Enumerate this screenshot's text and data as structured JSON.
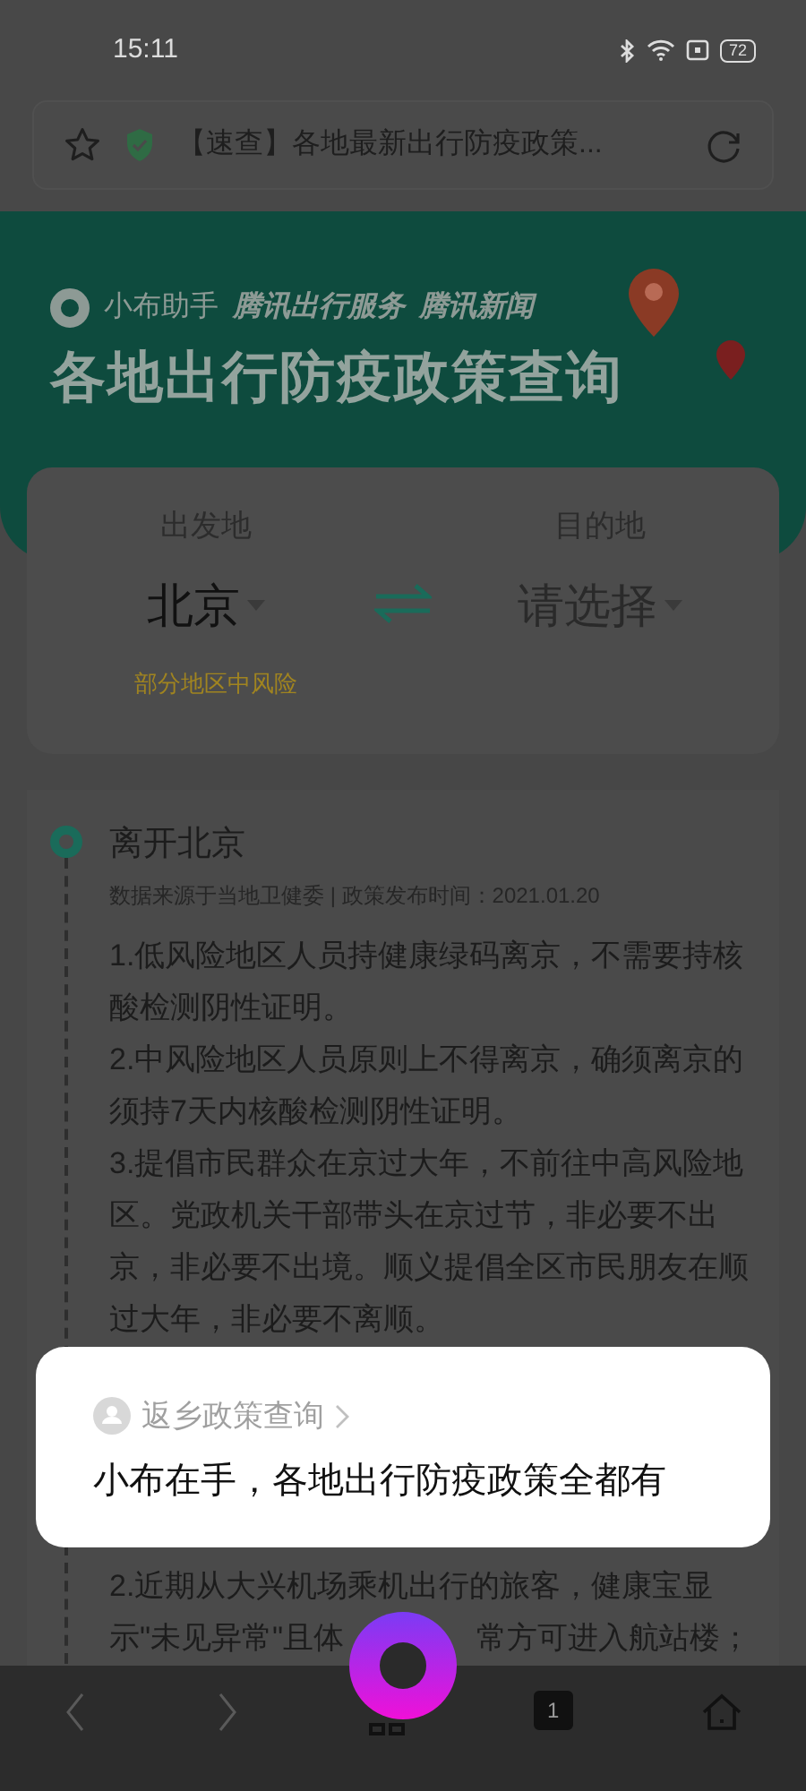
{
  "status_bar": {
    "time": "15:11",
    "battery": "72"
  },
  "address_bar": {
    "title": "【速查】各地最新出行防疫政策..."
  },
  "banner": {
    "brands": [
      "小布助手",
      "腾讯出行服务",
      "腾讯新闻"
    ],
    "title": "各地出行防疫政策查询"
  },
  "route_card": {
    "origin_label": "出发地",
    "origin": "北京",
    "destination_label": "目的地",
    "destination_placeholder": "请选择",
    "risk_note": "部分地区中风险"
  },
  "sections": [
    {
      "title": "离开北京",
      "source": "数据来源于当地卫健委 | 政策发布时间：2021.01.20",
      "paragraphs": [
        "1.低风险地区人员持健康绿码离京，不需要持核酸检测阴性证明。",
        "2.中风险地区人员原则上不得离京，确须离京的须持7天内核酸检测阴性证明。",
        "3.提倡市民群众在京过大年，不前往中高风险地区。党政机关干部带头在京过节，非必要不出京，非必要不出境。顺义提倡全区市民朋友在顺过大年，非必要不离顺。"
      ]
    }
  ],
  "continued": {
    "line_1": "2.近期从大兴机场乘机出行的旅客，健康宝显",
    "line_2_before": "示\"未见异常\"且体",
    "line_2_after": "常方可进入航站楼；"
  },
  "popup": {
    "source": "返乡政策查询",
    "message": "小布在手，各地出行防疫政策全都有"
  },
  "nav": {
    "tab_count": "1"
  }
}
